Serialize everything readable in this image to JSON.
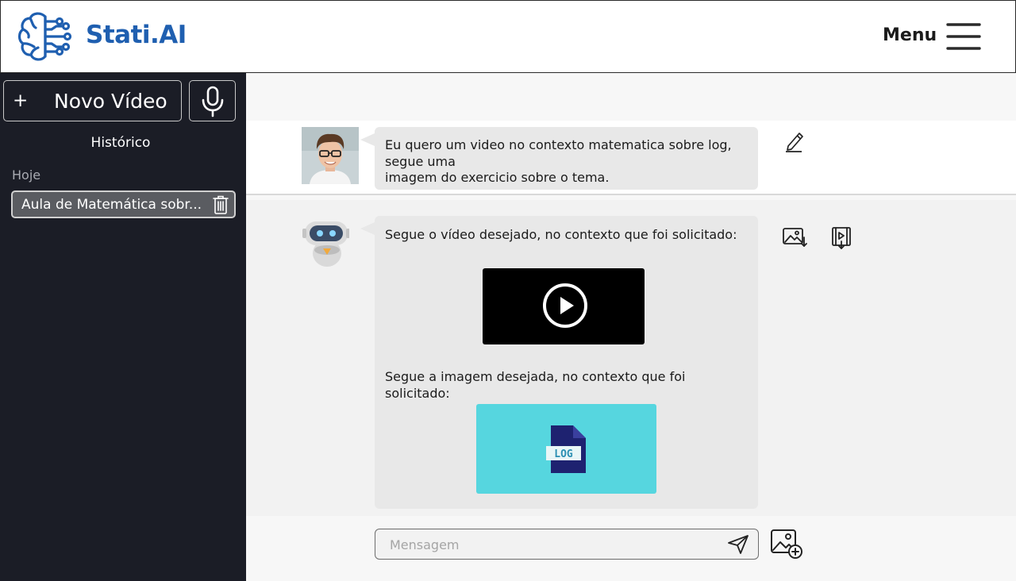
{
  "header": {
    "brand": "Stati.AI",
    "menu_label": "Menu"
  },
  "sidebar": {
    "new_video_plus": "+",
    "new_video_label": "Novo Vídeo",
    "history_title": "Histórico",
    "today_label": "Hoje",
    "history_items": [
      {
        "label": "Aula de Matemática sobr..."
      }
    ]
  },
  "chat": {
    "user_message": {
      "lines": [
        "Eu quero um video no contexto matematica sobre log,",
        "segue uma",
        "imagem do exercicio sobre o tema."
      ]
    },
    "bot_message": {
      "video_intro": "Segue o vídeo desejado, no contexto que foi solicitado:",
      "image_intro_lines": [
        "Segue a imagem desejada, no contexto que foi",
        "solicitado:"
      ],
      "image_badge": "LOG"
    }
  },
  "composer": {
    "placeholder": "Mensagem"
  },
  "colors": {
    "brand": "#1f5fb0",
    "sidebar_bg": "#1b1d26",
    "image_card_bg": "#56d6df",
    "log_file": "#1e2270"
  }
}
